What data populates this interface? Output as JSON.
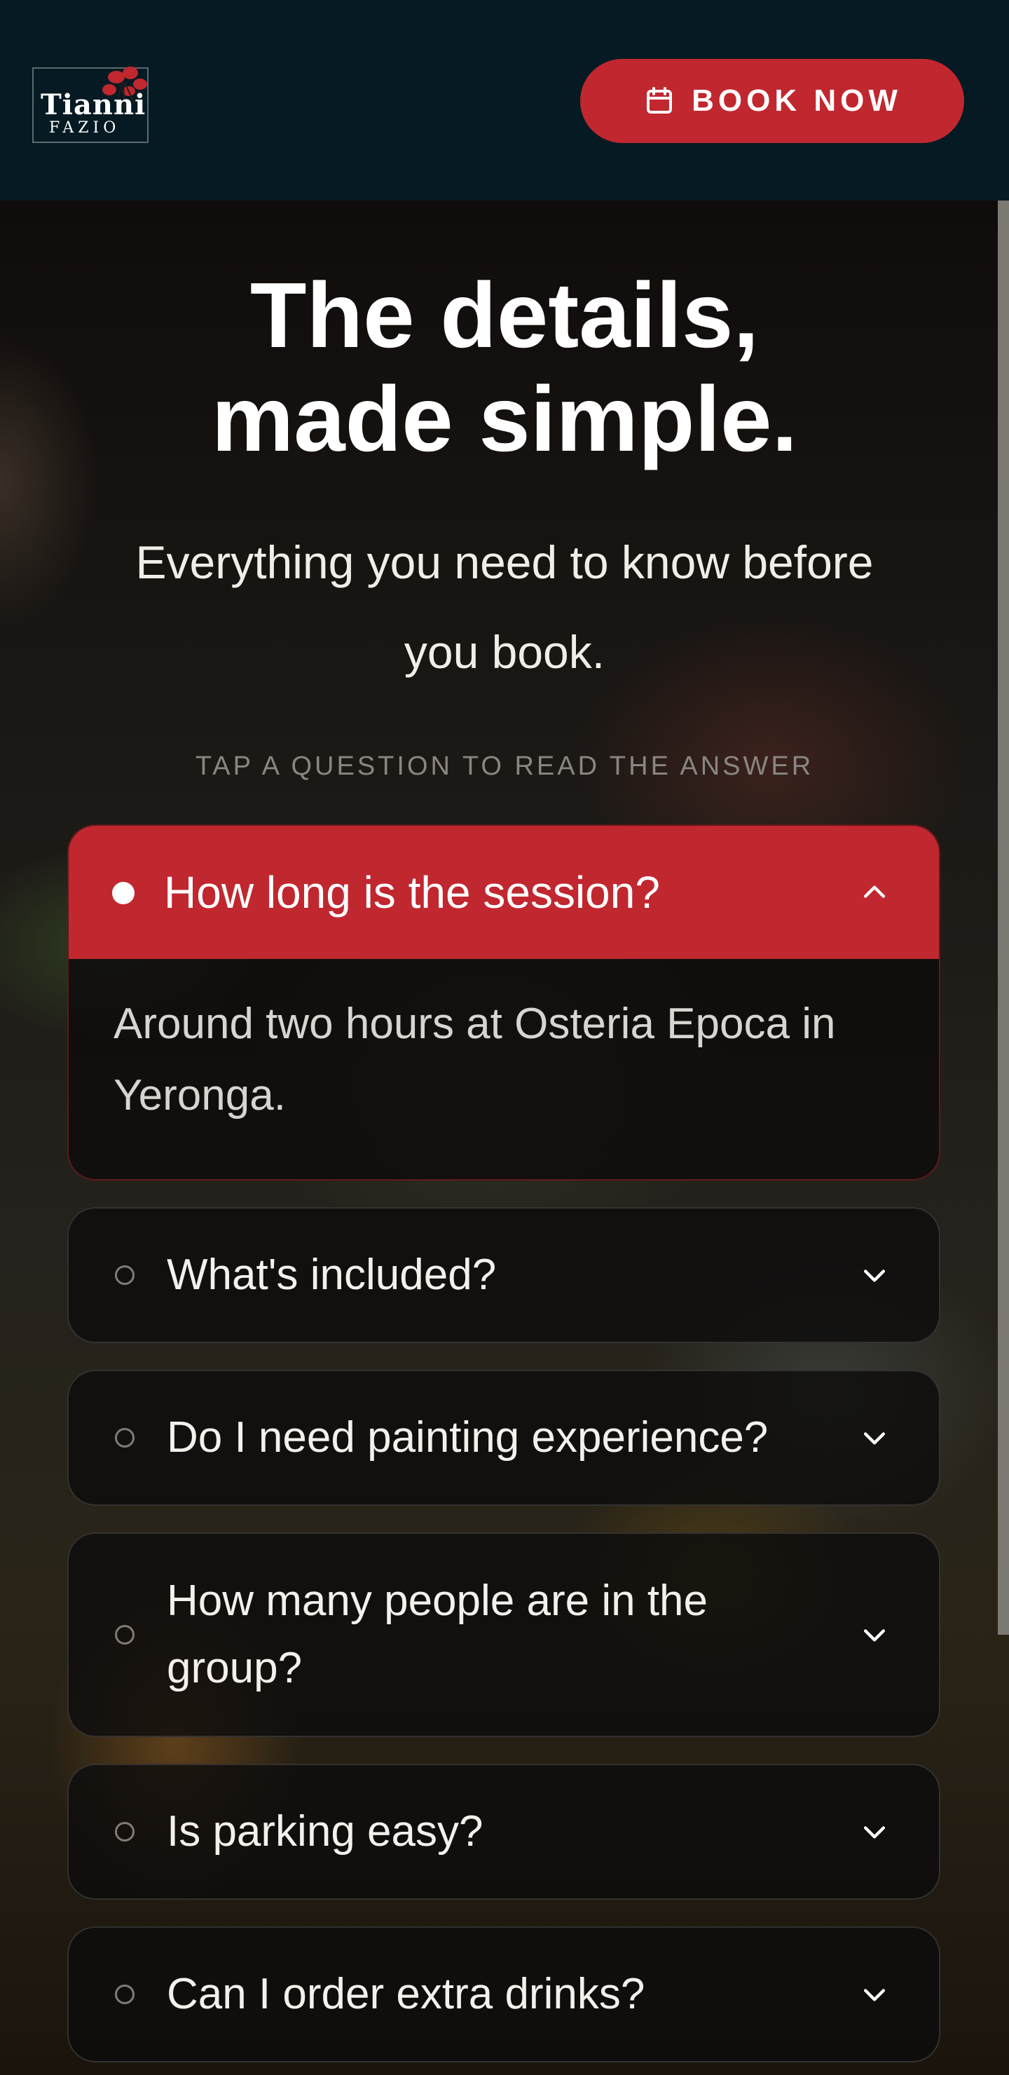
{
  "header": {
    "logo": {
      "name": "Tianni",
      "sub": "FAZIO"
    },
    "book_button": {
      "label": "BOOK NOW",
      "icon": "calendar-icon"
    }
  },
  "hero": {
    "title_line1": "The details,",
    "title_line2": "made simple.",
    "subtitle_line1": "Everything you need to know before",
    "subtitle_line2": "you book.",
    "hint": "TAP A QUESTION TO READ THE ANSWER"
  },
  "faq": {
    "open_item": {
      "question": "How long is the session?",
      "answer": "Around two hours at Osteria Epoca in Yeronga."
    },
    "items": [
      {
        "question": "What's included?"
      },
      {
        "question": "Do I need painting experience?"
      },
      {
        "question": "How many people are in the group?"
      },
      {
        "question": "Is parking easy?"
      },
      {
        "question": "Can I order extra drinks?"
      }
    ]
  },
  "colors": {
    "header_bg": "#051a22",
    "accent": "#c1272f",
    "card_bg": "#0e0c0c"
  }
}
